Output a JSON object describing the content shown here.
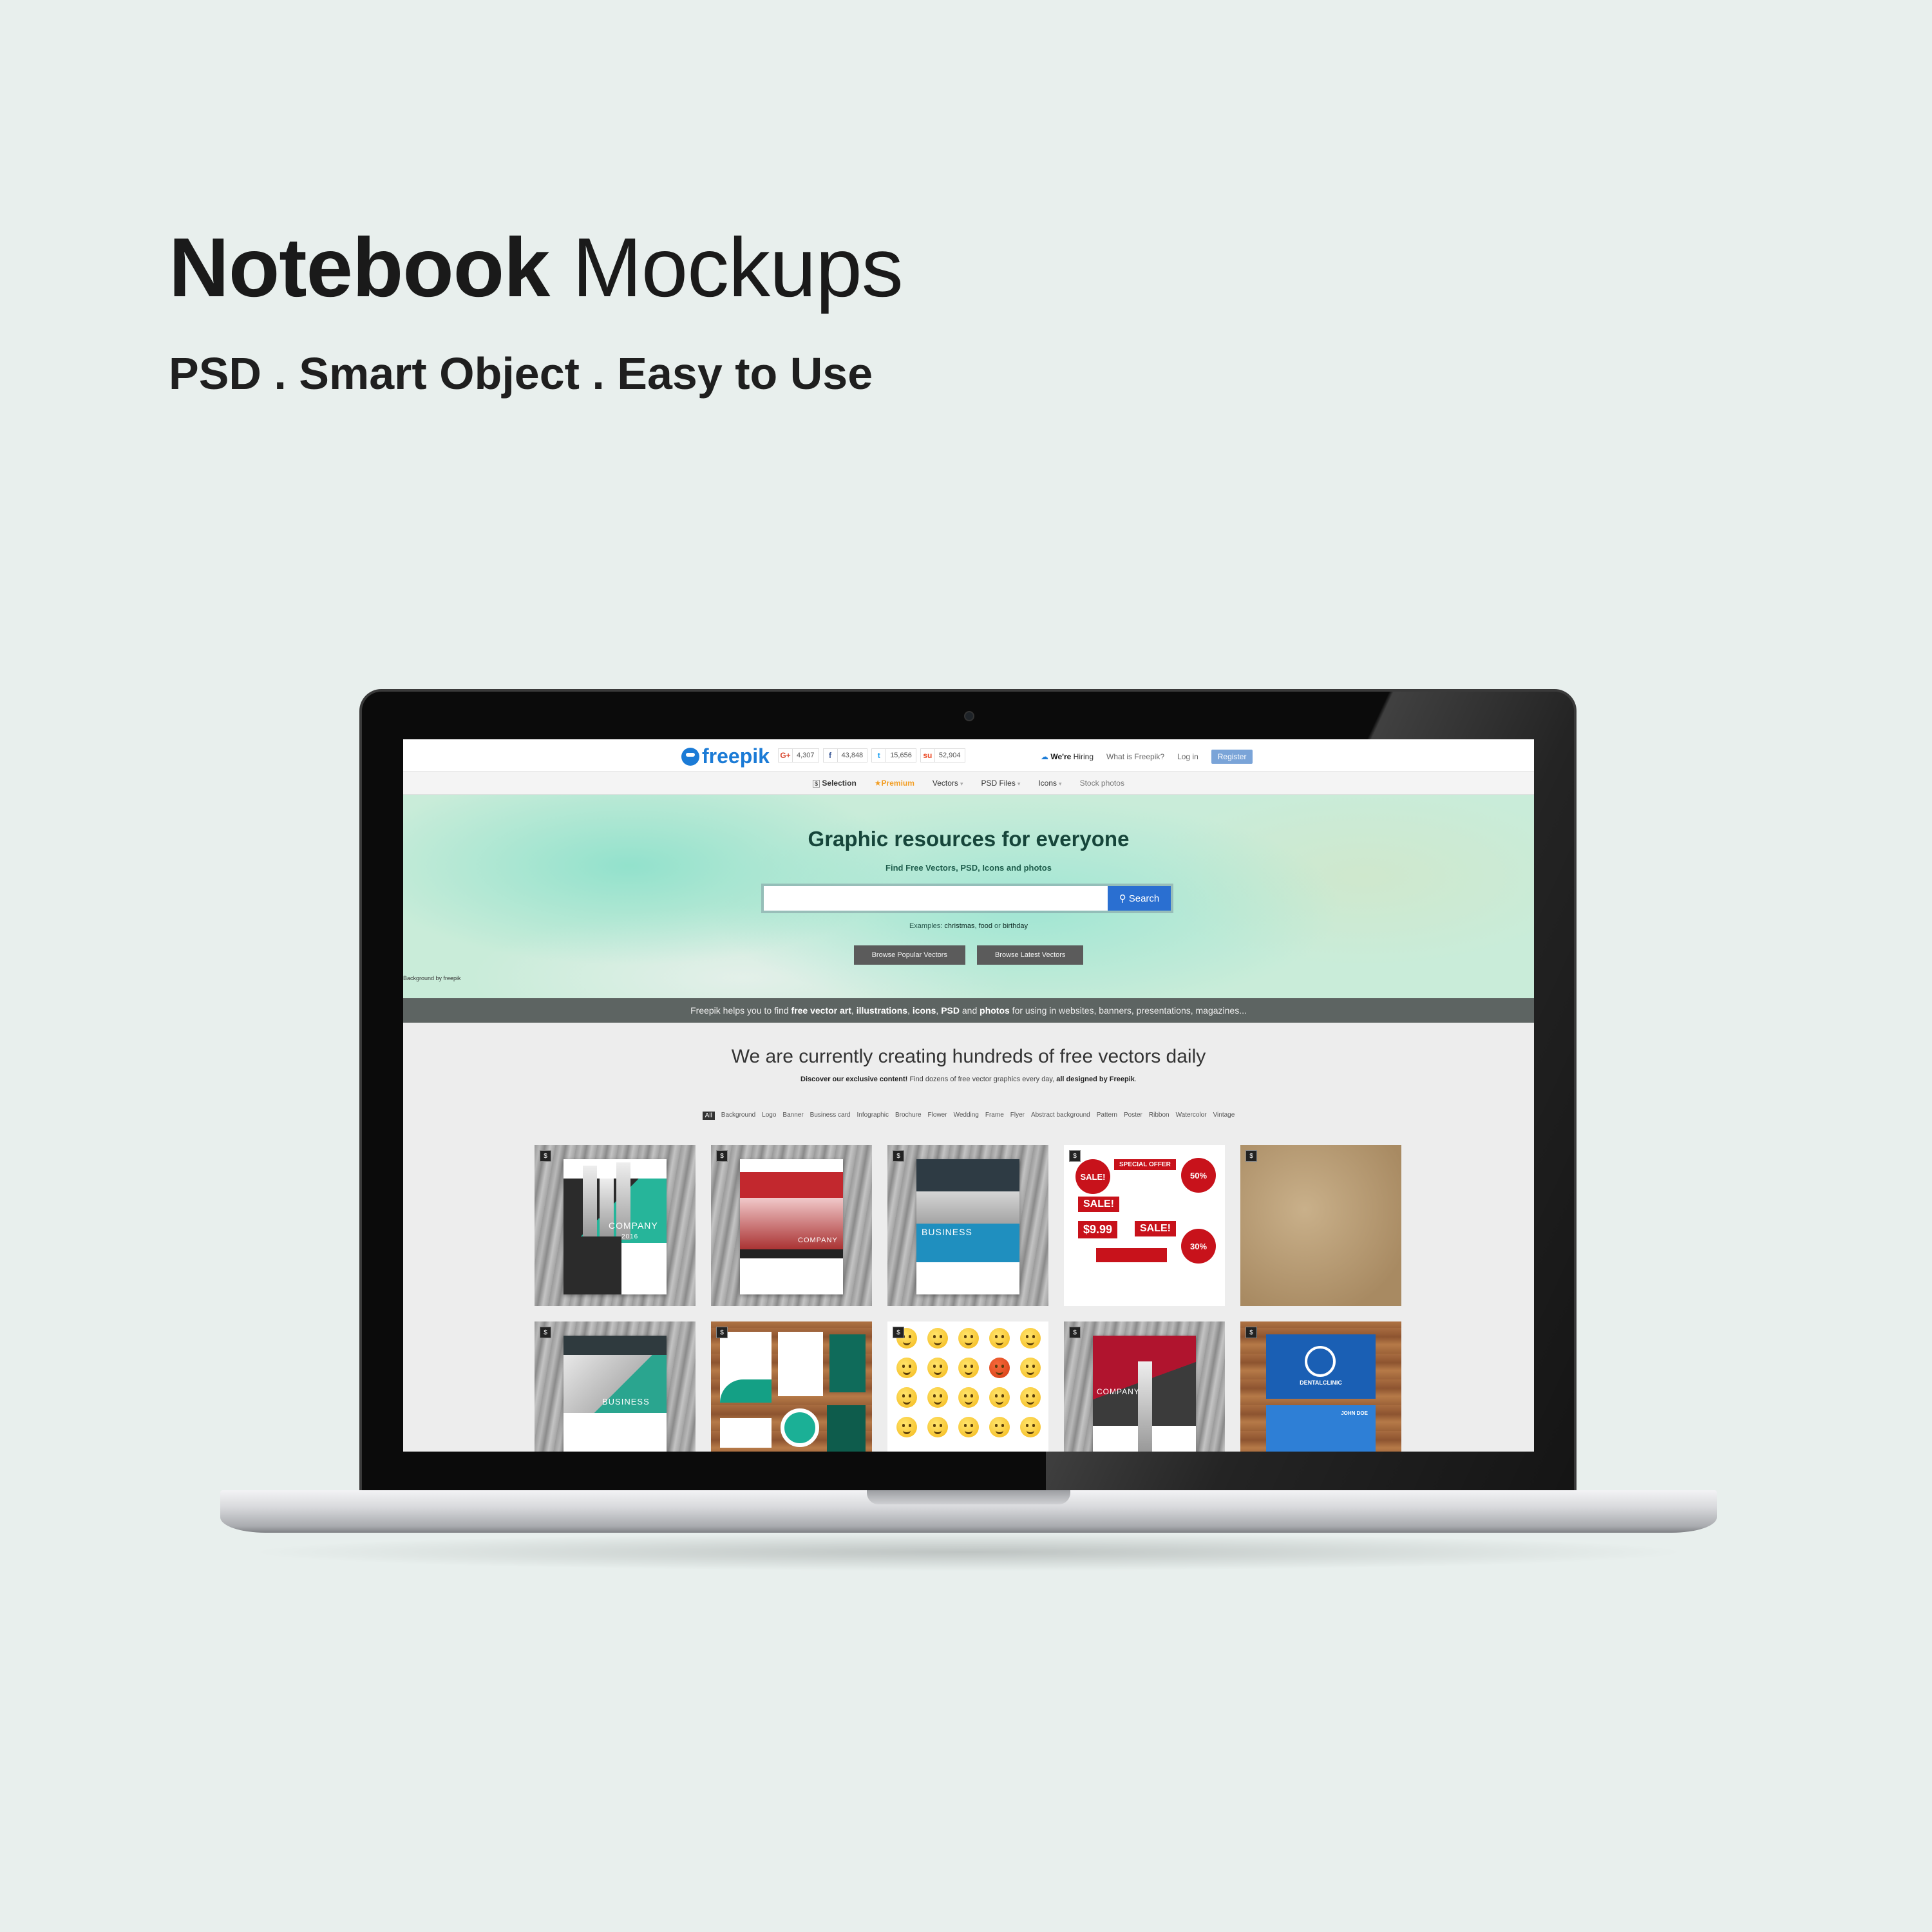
{
  "mockup": {
    "title_bold": "Notebook",
    "title_light": "Mockups",
    "subtitle": "PSD . Smart Object . Easy to Use"
  },
  "site": {
    "logo": "freepik",
    "social": [
      {
        "icon": "google-plus-icon",
        "glyph": "G+",
        "count": "4,307",
        "color": "#d8472f"
      },
      {
        "icon": "facebook-icon",
        "glyph": "f",
        "count": "43,848",
        "color": "#3b5998"
      },
      {
        "icon": "twitter-icon",
        "glyph": "t",
        "count": "15,656",
        "color": "#1da1f2"
      },
      {
        "icon": "stumbleupon-icon",
        "glyph": "su",
        "count": "52,904",
        "color": "#eb4924"
      }
    ],
    "top_links": {
      "hiring_bold": "We're",
      "hiring_rest": "Hiring",
      "what": "What is Freepik?",
      "login": "Log in",
      "register": "Register"
    },
    "nav": {
      "selection": "Selection",
      "premium": "Premium",
      "vectors": "Vectors",
      "psd": "PSD Files",
      "icons": "Icons",
      "stock": "Stock photos"
    },
    "hero": {
      "title": "Graphic resources for everyone",
      "subtitle": "Find Free Vectors, PSD, Icons and photos",
      "search_value": "",
      "search_button": "Search",
      "examples_label": "Examples:",
      "example_1": "christmas",
      "example_sep1": ",",
      "example_2": "food",
      "example_or": "or",
      "example_3": "birthday",
      "btn_popular": "Browse Popular Vectors",
      "btn_latest": "Browse Latest Vectors",
      "credit": "Background by freepik"
    },
    "infobar": {
      "t1": "Freepik helps you to find ",
      "b1": "free vector art",
      "t2": ", ",
      "b2": "illustrations",
      "t3": ", ",
      "b3": "icons",
      "t4": ", ",
      "b4": "PSD",
      "t5": " and ",
      "b5": "photos",
      "t6": " for using in websites, banners, presentations, magazines..."
    },
    "content": {
      "heading": "We are currently creating hundreds of free vectors daily",
      "disc_bold1": "Discover our exclusive content!",
      "disc_text": " Find dozens of free vector graphics every day, ",
      "disc_bold2": "all designed by Freepik",
      "disc_end": ".",
      "tags": [
        "All",
        "Background",
        "Logo",
        "Banner",
        "Business card",
        "Infographic",
        "Brochure",
        "Flower",
        "Wedding",
        "Frame",
        "Flyer",
        "Abstract background",
        "Pattern",
        "Poster",
        "Ribbon",
        "Watercolor",
        "Vintage"
      ]
    },
    "tiles": {
      "t1_caption": "COMPANY",
      "t1_year": "2016",
      "t2_caption": "COMPANY",
      "t3_caption": "BUSINESS",
      "t4_sale1": "SALE!",
      "t4_offer": "SPECIAL OFFER",
      "t4_50": "50%",
      "t4_price": "$9.99",
      "t4_sale2": "SALE!",
      "t4_sale3": "SALE!",
      "t4_30": "30%",
      "t6_caption": "BUSINESS",
      "t9_caption": "COMPANY",
      "t10_name": "DENTALCLINIC",
      "t10_john": "JOHN DOE",
      "badge": "$"
    }
  }
}
